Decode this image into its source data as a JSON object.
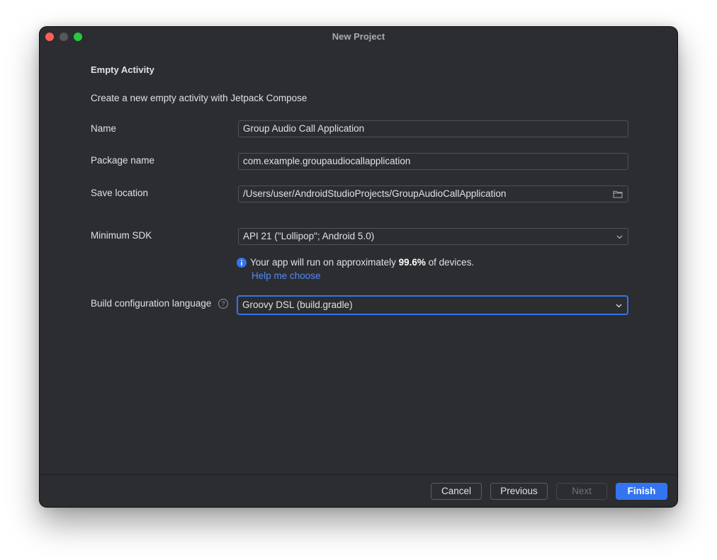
{
  "window": {
    "title": "New Project"
  },
  "heading": "Empty Activity",
  "description": "Create a new empty activity with Jetpack Compose",
  "fields": {
    "name": {
      "label": "Name",
      "value": "Group Audio Call Application"
    },
    "package": {
      "label": "Package name",
      "value": "com.example.groupaudiocallapplication"
    },
    "save_location": {
      "label": "Save location",
      "value": "/Users/user/AndroidStudioProjects/GroupAudioCallApplication",
      "icon": "folder-icon"
    },
    "min_sdk": {
      "label": "Minimum SDK",
      "value": "API 21 (\"Lollipop\"; Android 5.0)"
    },
    "build_lang": {
      "label": "Build configuration language",
      "value": "Groovy DSL (build.gradle)"
    }
  },
  "info": {
    "prefix": "Your app will run on approximately ",
    "percent": "99.6%",
    "suffix": " of devices.",
    "help_link": "Help me choose"
  },
  "buttons": {
    "cancel": "Cancel",
    "previous": "Previous",
    "next": "Next",
    "finish": "Finish"
  },
  "colors": {
    "background": "#2b2d30",
    "accent": "#3574f0",
    "link": "#548af7",
    "text": "#dfe1e5"
  }
}
